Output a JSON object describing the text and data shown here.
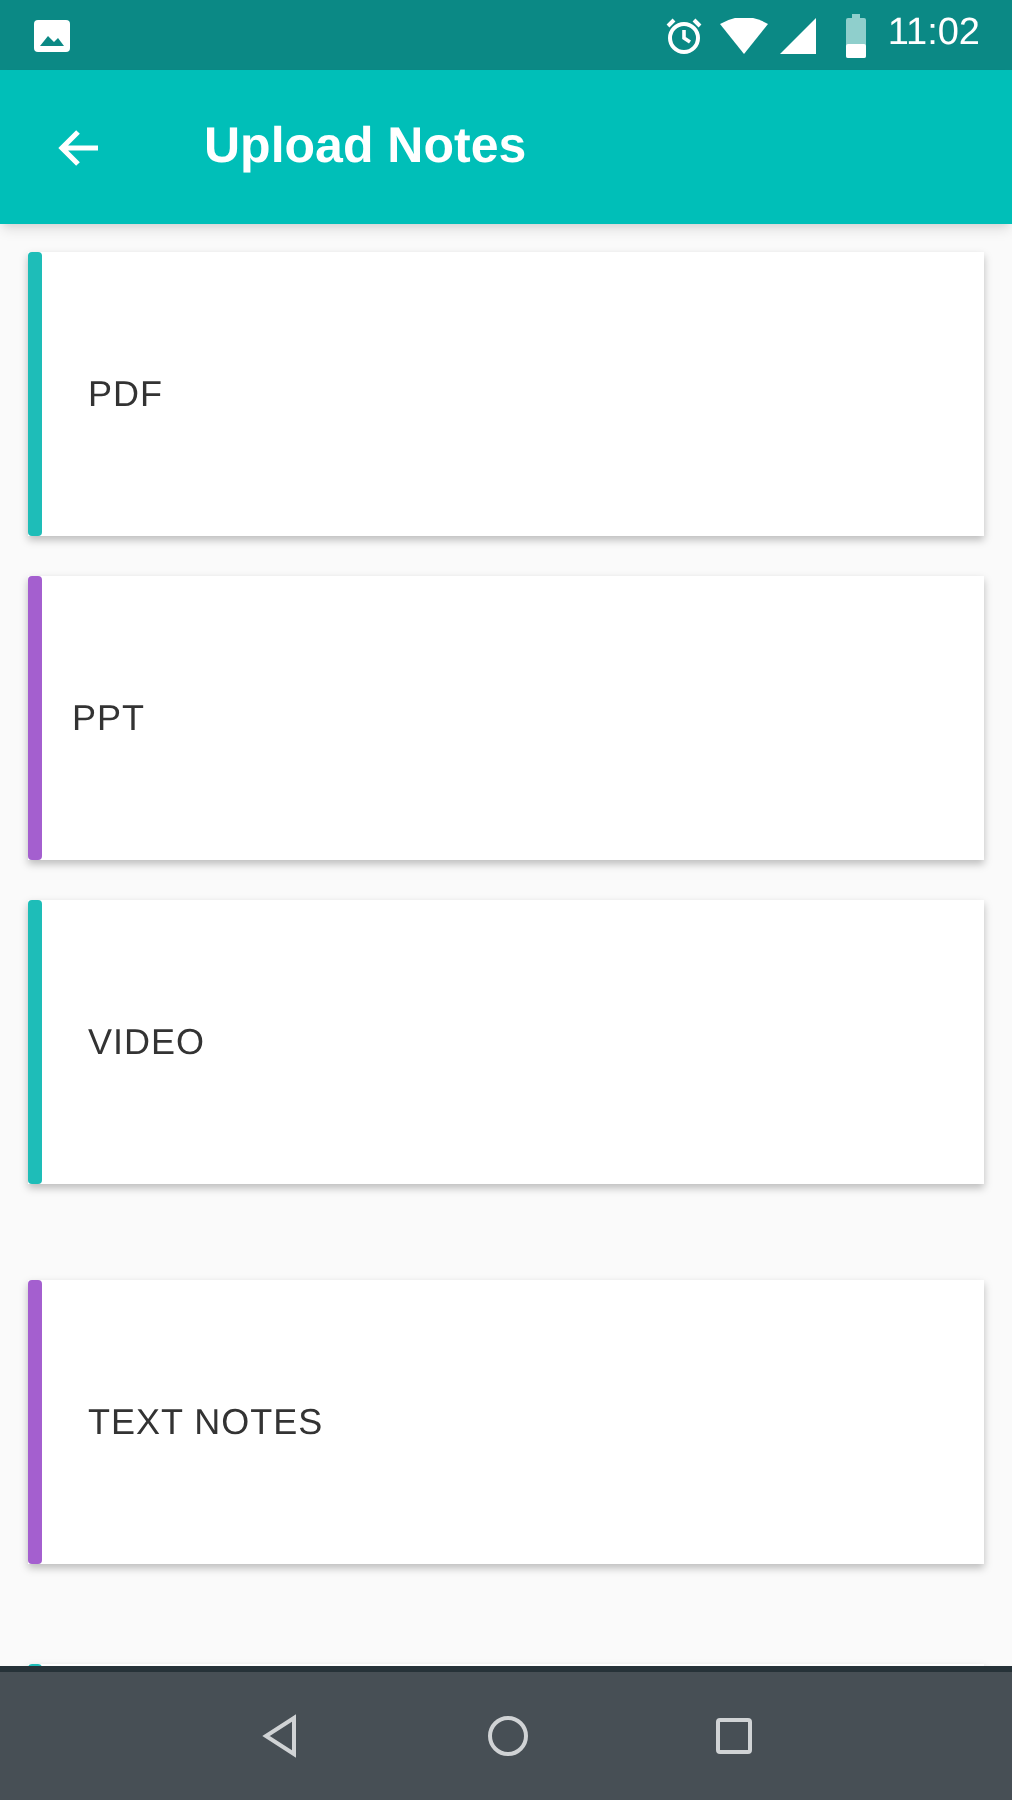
{
  "status_bar": {
    "time": "11:02"
  },
  "app_bar": {
    "title": "Upload Notes"
  },
  "cards": [
    {
      "label": "PDF",
      "color": "#1ebdb8"
    },
    {
      "label": "PPT",
      "color": "#a45fcf"
    },
    {
      "label": "VIDEO",
      "color": "#1ebdb8"
    },
    {
      "label": "TEXT NOTES",
      "color": "#a45fcf"
    },
    {
      "color": "#1ebdb8"
    }
  ]
}
